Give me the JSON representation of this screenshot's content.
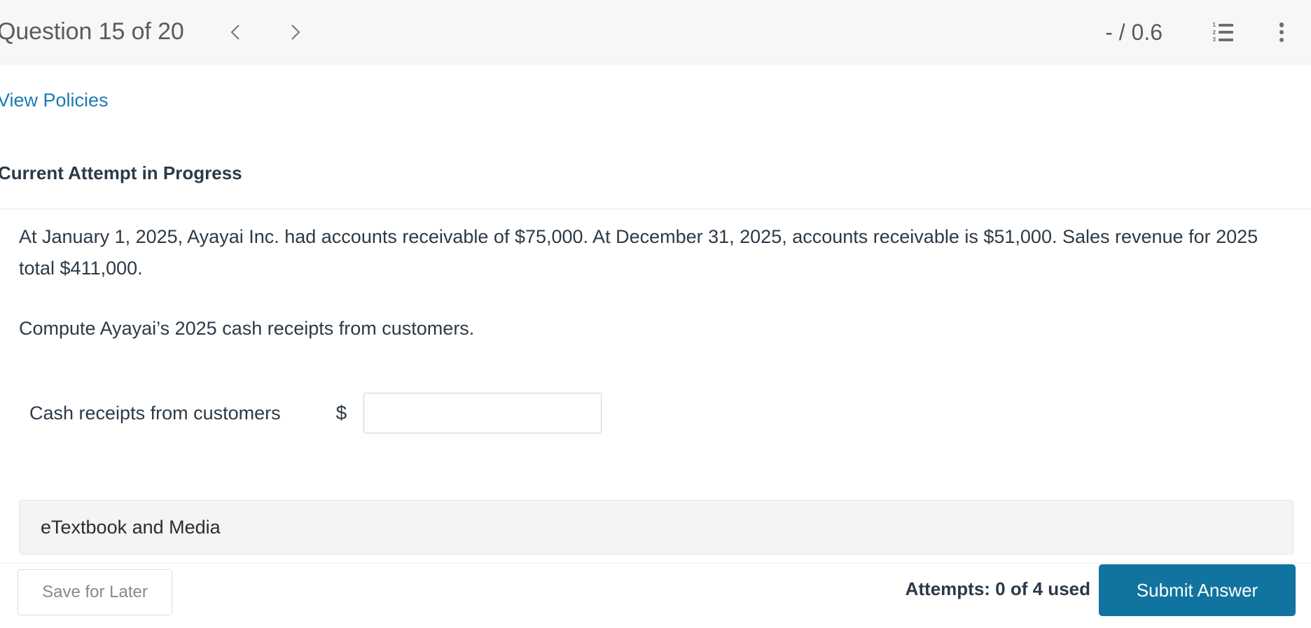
{
  "header": {
    "question_title": "Question 15 of 20",
    "prev_icon": "chevron-left-icon",
    "next_icon": "chevron-right-icon",
    "score": "- / 0.6",
    "list_icon": "numbered-list-icon",
    "list_numbers": [
      "1",
      "2",
      "3"
    ],
    "menu_icon": "kebab-menu-icon"
  },
  "links": {
    "view_policies": "View Policies"
  },
  "section": {
    "attempt_heading": "Current Attempt in Progress"
  },
  "question": {
    "paragraph_1": "At January 1, 2025, Ayayai Inc. had accounts receivable of $75,000. At December 31, 2025, accounts receivable is $51,000. Sales revenue for 2025 total $411,000.",
    "paragraph_2": "Compute Ayayai’s 2025 cash receipts from customers."
  },
  "answer": {
    "label": "Cash receipts from customers",
    "currency_symbol": "$",
    "value": "",
    "placeholder": ""
  },
  "etextbook": {
    "label": "eTextbook and Media"
  },
  "footer": {
    "save_label": "Save for Later",
    "attempts_text": "Attempts: 0 of 4 used",
    "submit_label": "Submit Answer"
  },
  "colors": {
    "link_blue": "#1b7bb0",
    "submit_blue": "#11739f",
    "header_bg": "#f7f7f7",
    "text_dark": "#2c3a47"
  }
}
